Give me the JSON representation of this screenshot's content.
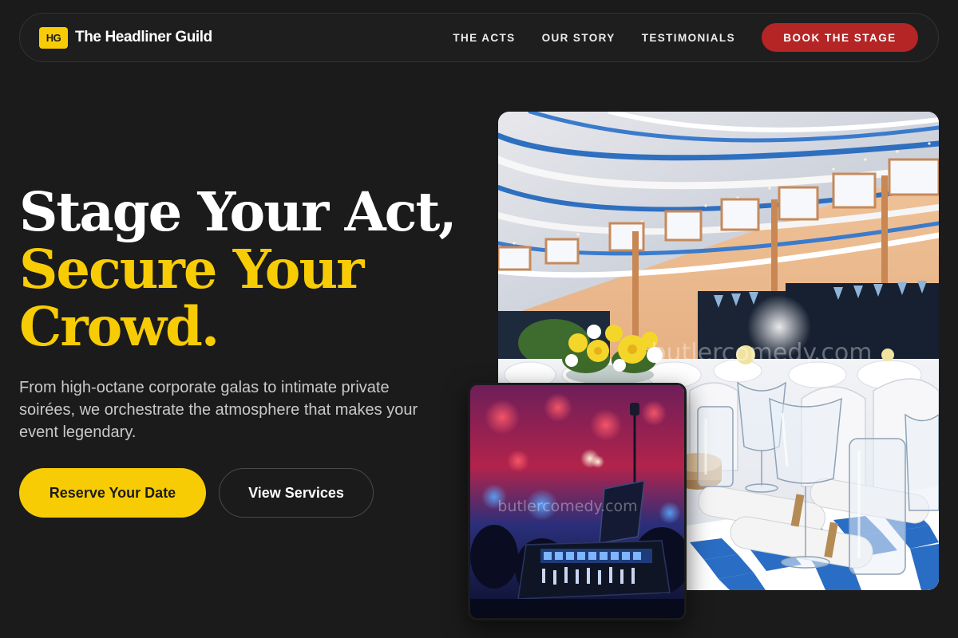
{
  "nav": {
    "logo_text": "HG",
    "brand_name": "The Headliner Guild",
    "links": [
      "THE ACTS",
      "OUR STORY",
      "TESTIMONIALS"
    ],
    "cta": "BOOK THE STAGE"
  },
  "hero": {
    "headline_line1": "Stage Your Act,",
    "headline_line2": "Secure Your",
    "headline_line3": "Crowd.",
    "subtext": "From high-octane corporate galas to intimate private soirées, we orchestrate the atmosphere that makes your event legendary.",
    "primary_cta": "Reserve Your Date",
    "secondary_cta": "View Services"
  },
  "images": {
    "main_watermark": "butlercomedy.com",
    "inset_watermark": "butlercomedy.com"
  },
  "colors": {
    "background": "#1b1b1b",
    "accent_yellow": "#f8cc05",
    "accent_red": "#b52525"
  }
}
